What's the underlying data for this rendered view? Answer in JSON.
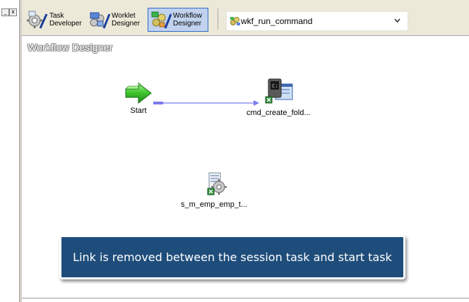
{
  "left_pane": {
    "minimize_glyph": "_",
    "close_glyph": "x"
  },
  "toolbar": {
    "buttons": [
      {
        "line1": "Task",
        "line2": "Developer",
        "icon": "task-developer-icon",
        "active": false
      },
      {
        "line1": "Worklet",
        "line2": "Designer",
        "icon": "worklet-designer-icon",
        "active": false
      },
      {
        "line1": "Workflow",
        "line2": "Designer",
        "icon": "workflow-designer-icon",
        "active": true
      }
    ],
    "workflow_select": {
      "value": "wkf_run_command",
      "icon": "workflow-icon"
    }
  },
  "canvas": {
    "title": "Workflow Designer",
    "tasks": [
      {
        "label": "Start",
        "icon": "start-arrow-icon"
      },
      {
        "label": "cmd_create_fold...",
        "icon": "command-task-icon"
      },
      {
        "label": "s_m_emp_emp_t...",
        "icon": "session-task-icon"
      }
    ],
    "link_color": "#7b7bf0"
  },
  "callout": {
    "text": "Link is removed between the session task and start task",
    "background": "#1f4d7b"
  }
}
